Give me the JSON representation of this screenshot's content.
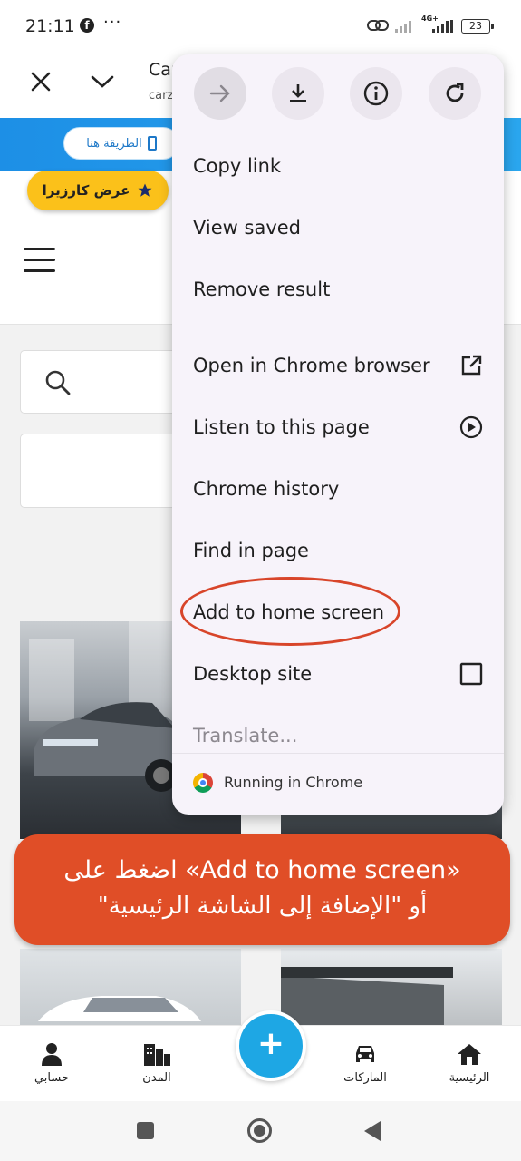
{
  "status_bar": {
    "time": "21:11",
    "net_top": "4G+",
    "battery": "23"
  },
  "toolbar": {
    "title": "Car",
    "url": "carz"
  },
  "site": {
    "banner_pill": "الطريقة هنا",
    "cta_label": "عرض كارزيرا"
  },
  "menu": {
    "items": [
      {
        "label": "Copy link"
      },
      {
        "label": "View saved"
      },
      {
        "label": "Remove result"
      },
      {
        "label": "Open in Chrome browser",
        "icon": "open-external-icon"
      },
      {
        "label": "Listen to this page",
        "icon": "play-circle-icon"
      },
      {
        "label": "Chrome history"
      },
      {
        "label": "Find in page"
      },
      {
        "label": "Add to home screen"
      },
      {
        "label": "Desktop site",
        "icon": "checkbox-icon"
      },
      {
        "label": "Translate..."
      }
    ],
    "footer": "Running in Chrome"
  },
  "callout": {
    "line1": "اضغط على «Add to home screen»",
    "line2": "أو \"الإضافة إلى الشاشة الرئيسية\"",
    "color": "#e04e27"
  },
  "bottom_nav": {
    "items": [
      {
        "label": "حسابي",
        "icon": "account-icon"
      },
      {
        "label": "المدن",
        "icon": "city-icon"
      },
      {
        "label": "الماركات",
        "icon": "car-icon"
      },
      {
        "label": "الرئيسية",
        "icon": "home-icon"
      }
    ],
    "fab": "+"
  },
  "colors": {
    "accent": "#1ea7e4",
    "banner": "#1d8fe6",
    "cta": "#fbc11a"
  }
}
